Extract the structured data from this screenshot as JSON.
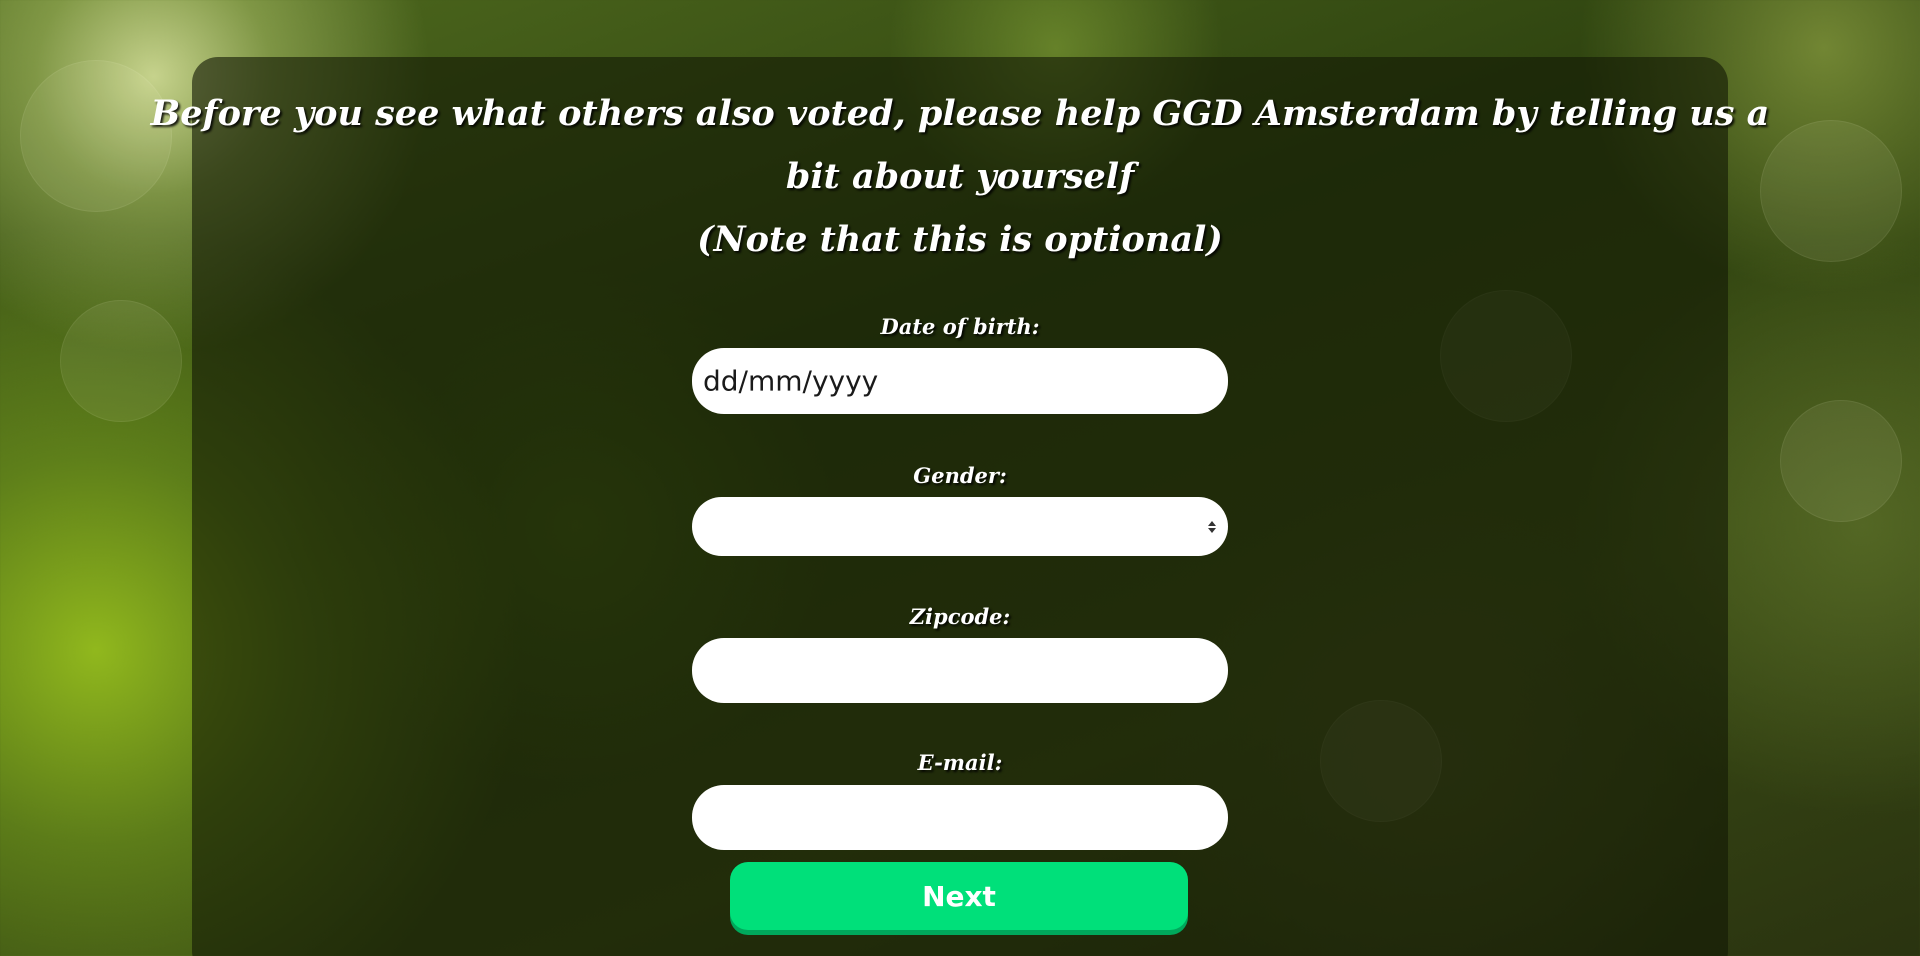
{
  "heading": {
    "line1": "Before you see what others also voted, please help GGD Amsterdam by telling us a",
    "line2": "bit about yourself",
    "line3": "(Note that this is optional)"
  },
  "form": {
    "dob": {
      "label": "Date of birth:",
      "value": "dd/mm/yyyy"
    },
    "gender": {
      "label": "Gender:",
      "value": ""
    },
    "zipcode": {
      "label": "Zipcode:",
      "value": ""
    },
    "email": {
      "label": "E-mail:",
      "value": ""
    },
    "next_label": "Next"
  },
  "colors": {
    "button": "#00e07a",
    "button_shadow": "#00a85c",
    "panel": "rgba(20,26,5,0.62)",
    "text": "#ffffff"
  }
}
